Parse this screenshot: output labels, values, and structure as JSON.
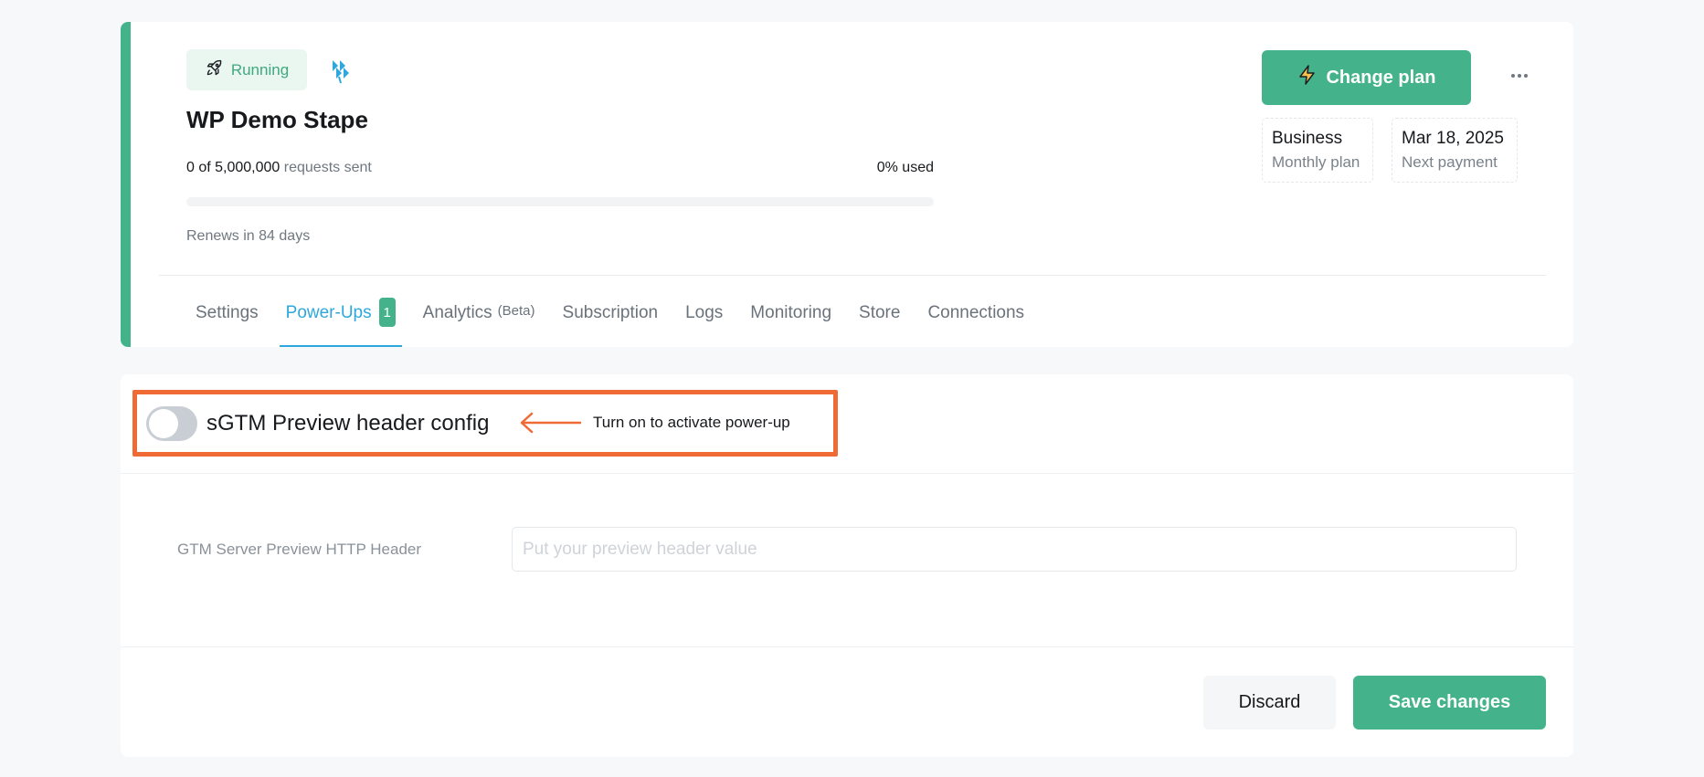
{
  "colors": {
    "accent": "#44b38b",
    "active_tab": "#2ea7dc",
    "highlight": "#ef6a35",
    "page_bg": "#f7f8fa"
  },
  "container": {
    "status_label": "Running",
    "status_icon": "rocket-icon",
    "brand_icon": "stape-logo-icon",
    "title": "WP Demo Stape",
    "usage": {
      "sent": "0 of 5,000,000",
      "sent_suffix": "requests sent",
      "percent_label": "0% used",
      "percent_used": 0
    },
    "renews": "Renews in 84 days"
  },
  "plan": {
    "change_plan_label": "Change plan",
    "change_plan_icon": "lightning-icon",
    "more_icon": "more-dots-icon",
    "plan_name": "Business",
    "plan_period": "Monthly plan",
    "next_payment_date": "Mar 18, 2025",
    "next_payment_label": "Next payment"
  },
  "tabs": [
    {
      "label": "Settings"
    },
    {
      "label": "Power-Ups",
      "badge": "1",
      "active": true
    },
    {
      "label": "Analytics",
      "suffix": "(Beta)"
    },
    {
      "label": "Subscription"
    },
    {
      "label": "Logs"
    },
    {
      "label": "Monitoring"
    },
    {
      "label": "Store"
    },
    {
      "label": "Connections"
    }
  ],
  "powerup": {
    "title": "sGTM Preview header config",
    "toggle_on": false,
    "annotation": "Turn on to activate power-up",
    "field_label": "GTM Server Preview HTTP Header",
    "field_value": "",
    "field_placeholder": "Put your preview header value",
    "discard_label": "Discard",
    "save_label": "Save changes"
  }
}
